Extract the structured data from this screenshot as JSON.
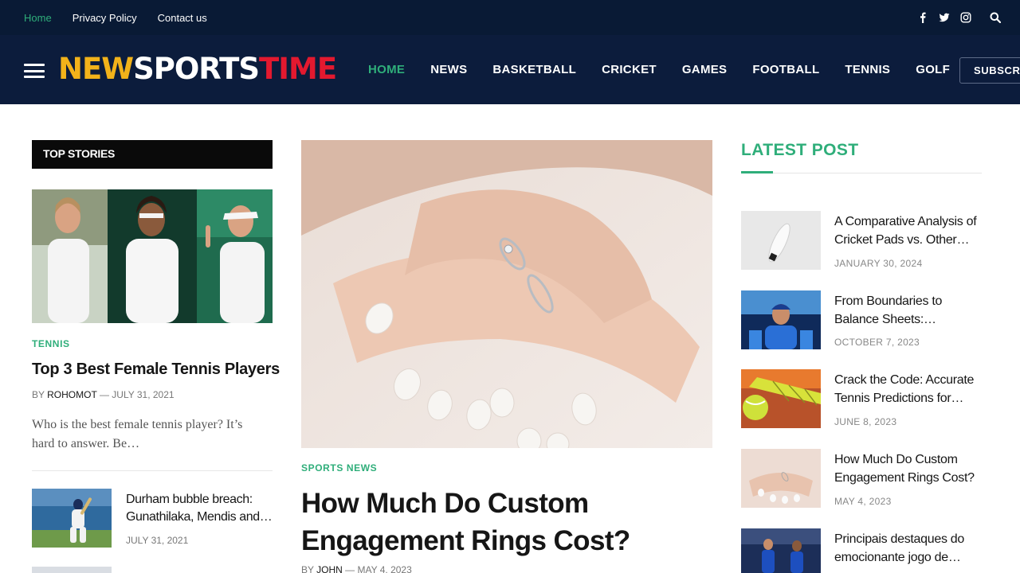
{
  "topbar": {
    "links": [
      "Home",
      "Privacy Policy",
      "Contact us"
    ],
    "social_icons": [
      "facebook-icon",
      "twitter-icon",
      "instagram-icon"
    ],
    "search_icon": "search-icon"
  },
  "header": {
    "logo": {
      "part1": "NEW",
      "part2": "SPORTS",
      "part3": "TIME"
    },
    "nav": [
      "HOME",
      "NEWS",
      "BASKETBALL",
      "CRICKET",
      "GAMES",
      "FOOTBALL",
      "TENNIS",
      "GOLF"
    ],
    "subscribe_label": "SUBSCRIBE"
  },
  "left": {
    "section_title": "TOP STORIES",
    "main_story": {
      "category": "TENNIS",
      "title": "Top 3 Best Female Tennis Players",
      "by": "BY",
      "author": "ROHOMOT",
      "date": "JULY 31, 2021",
      "excerpt": "Who is the best female tennis player? It’s hard to answer. Be…"
    },
    "small_stories": [
      {
        "title": "Durham bubble breach: Gunathilaka, Mendis and…",
        "date": "JULY 31, 2021"
      }
    ]
  },
  "featured": {
    "category": "SPORTS NEWS",
    "title": "How Much Do Custom Engagement Rings Cost?",
    "by": "BY",
    "author": "JOHN",
    "date": "MAY 4, 2023"
  },
  "latest": {
    "title": "LATEST POST",
    "posts": [
      {
        "title": "A Comparative Analysis of Cricket Pads vs. Other…",
        "date": "JANUARY 30, 2024"
      },
      {
        "title": "From Boundaries to Balance Sheets:…",
        "date": "OCTOBER 7, 2023"
      },
      {
        "title": "Crack the Code: Accurate Tennis Predictions for…",
        "date": "JUNE 8, 2023"
      },
      {
        "title": "How Much Do Custom Engagement Rings Cost?",
        "date": "MAY 4, 2023"
      },
      {
        "title": "Principais destaques do emocionante jogo de…",
        "date": ""
      }
    ]
  },
  "colors": {
    "accent": "#2fae7a",
    "topbar": "#091a35",
    "header": "#0c1c3c",
    "logo_yellow": "#f2b21a",
    "logo_red": "#e3192f"
  }
}
